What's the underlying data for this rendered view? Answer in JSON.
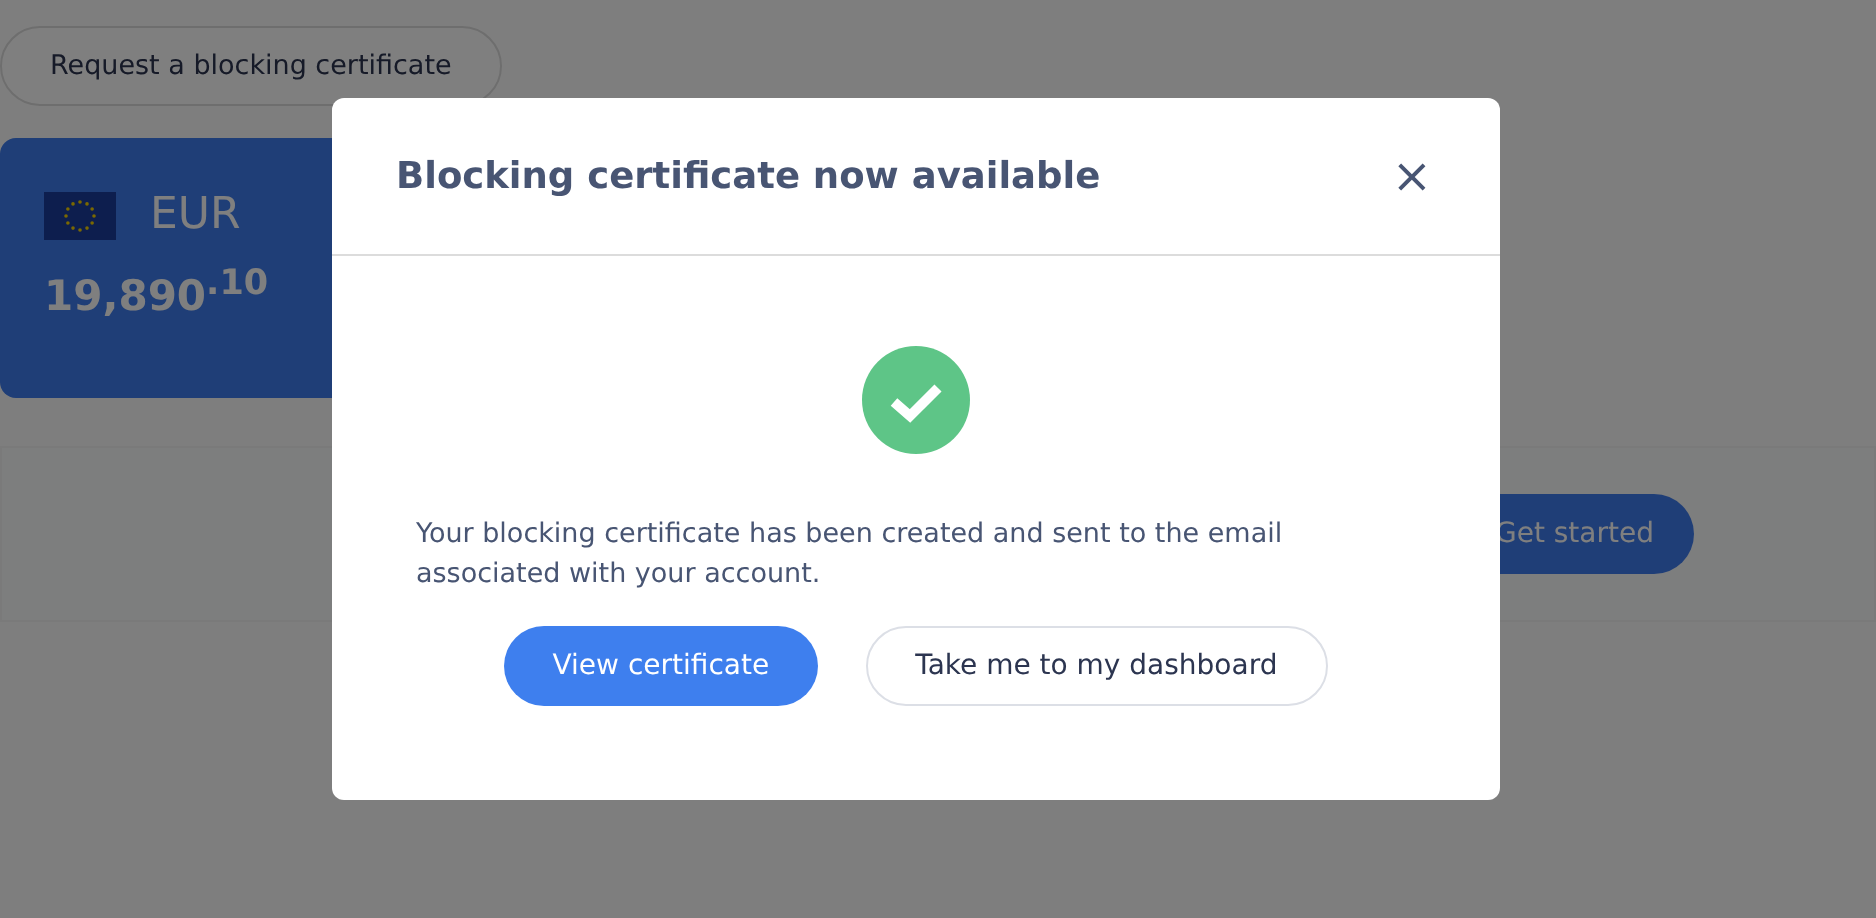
{
  "page": {
    "request_button": "Request a blocking certificate",
    "account_card": {
      "currency": "EUR",
      "balance": "19,890$^{.10}$"
    },
    "banner": {
      "button": "Get started"
    }
  },
  "dialog": {
    "title": "Blocking certificate now available",
    "close": "×",
    "message": "Your blocking certificate has been created and sent to the email associated with your account.",
    "buttons": [
      {
        "label": "View certificate",
        "kind": "primary"
      },
      {
        "label": "Take me to my dashboard",
        "kind": "secondary"
      }
    ]
  }
}
